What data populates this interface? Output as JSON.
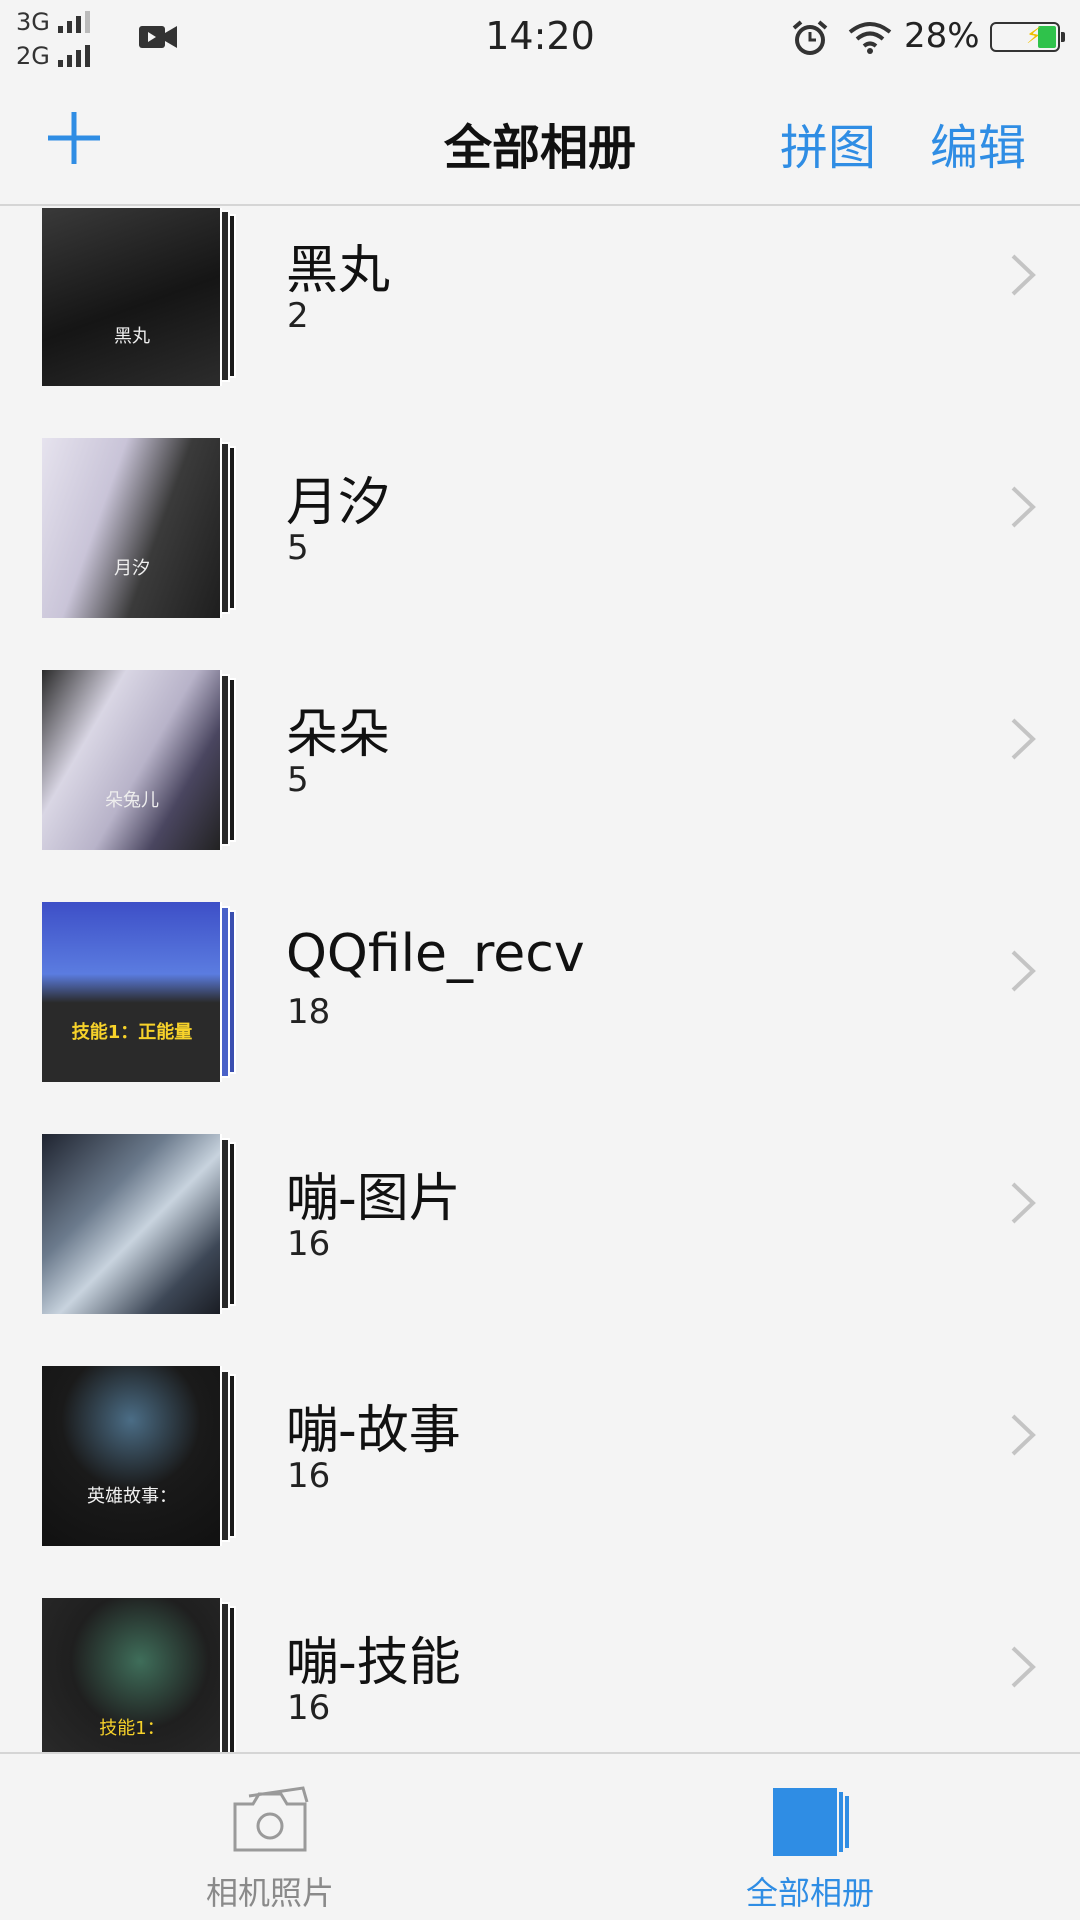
{
  "status_bar": {
    "network1": "3G",
    "network2": "2G",
    "time": "14:20",
    "battery_percent": "28%",
    "icons": [
      "video-icon",
      "alarm-icon",
      "wifi-icon",
      "battery-icon"
    ]
  },
  "nav": {
    "title": "全部相册",
    "collage_label": "拼图",
    "edit_label": "编辑",
    "add_icon": "plus-icon"
  },
  "albums": [
    {
      "name": "黑丸",
      "count": "2",
      "thumb_caption": "黑丸"
    },
    {
      "name": "月汐",
      "count": "5",
      "thumb_caption": "月汐"
    },
    {
      "name": "朵朵",
      "count": "5",
      "thumb_caption": "朵兔儿"
    },
    {
      "name": "QQfile_recv",
      "count": "18",
      "thumb_caption": "技能1：正能量"
    },
    {
      "name": "嘣-图片",
      "count": "16",
      "thumb_caption": ""
    },
    {
      "name": "嘣-故事",
      "count": "16",
      "thumb_caption": "英雄故事："
    },
    {
      "name": "嘣-技能",
      "count": "16",
      "thumb_caption": "技能1："
    }
  ],
  "tabbar": {
    "camera_label": "相机照片",
    "albums_label": "全部相册"
  },
  "colors": {
    "accent": "#2f8de4",
    "inactive": "#8a8a8a",
    "background": "#f4f4f4"
  }
}
